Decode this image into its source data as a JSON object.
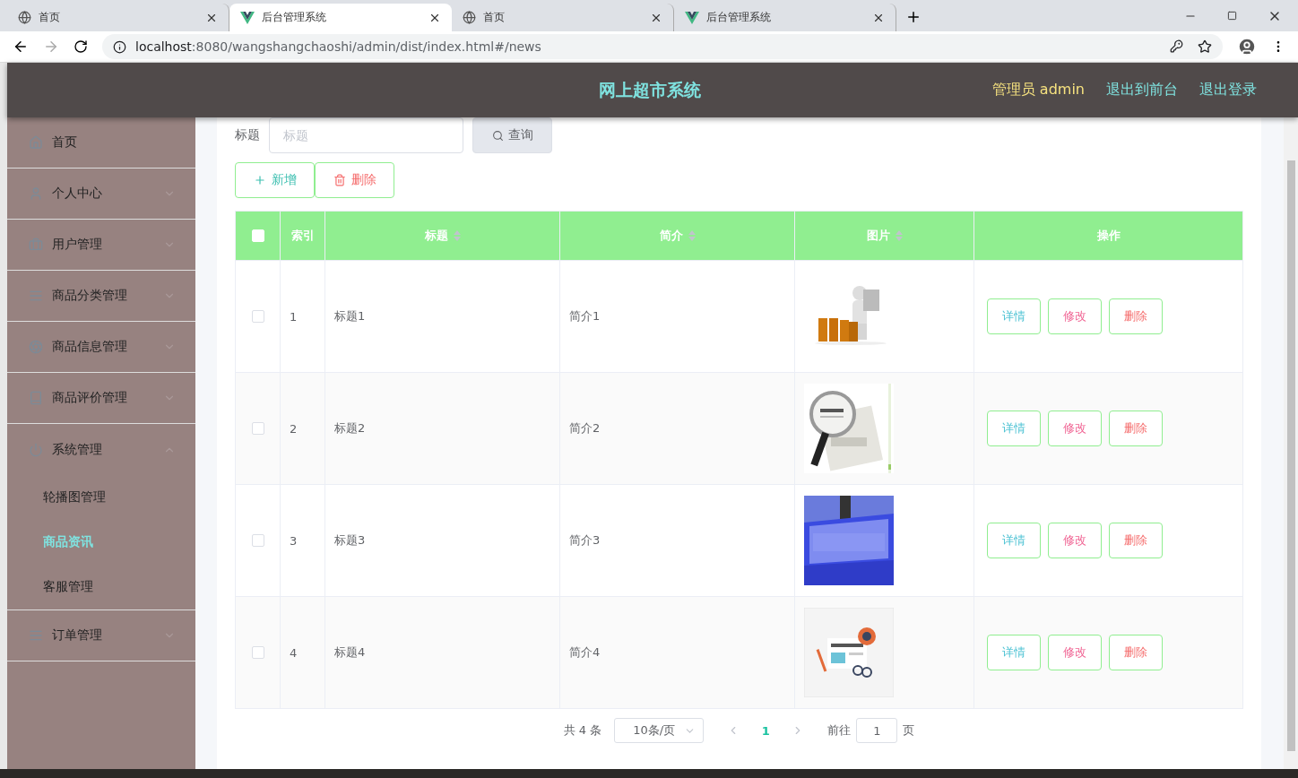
{
  "browser": {
    "tabs": [
      {
        "title": "首页",
        "kind": "globe",
        "selected": false
      },
      {
        "title": "后台管理系统",
        "kind": "vue",
        "selected": true
      },
      {
        "title": "首页",
        "kind": "globe",
        "selected": false
      },
      {
        "title": "后台管理系统",
        "kind": "vue",
        "selected": false
      }
    ],
    "url_host": "localhost",
    "url_rest": ":8080/wangshangchaoshi/admin/dist/index.html#/news"
  },
  "header": {
    "title": "网上超市系统",
    "user": "管理员 admin",
    "links": [
      "退出到前台",
      "退出登录"
    ]
  },
  "sidebar": {
    "items": [
      {
        "label": "首页"
      },
      {
        "label": "个人中心",
        "expanded": false
      },
      {
        "label": "用户管理",
        "expanded": false
      },
      {
        "label": "商品分类管理",
        "expanded": false
      },
      {
        "label": "商品信息管理",
        "expanded": false
      },
      {
        "label": "商品评价管理",
        "expanded": false
      },
      {
        "label": "系统管理",
        "expanded": true,
        "children": [
          {
            "label": "轮播图管理",
            "selected": false
          },
          {
            "label": "商品资讯",
            "selected": true
          },
          {
            "label": "客服管理",
            "selected": false
          }
        ]
      },
      {
        "label": "订单管理",
        "expanded": false
      }
    ]
  },
  "search": {
    "label": "标题",
    "placeholder": "标题",
    "button": "查询"
  },
  "toolbar": [
    {
      "label": "新增",
      "kind": "add"
    },
    {
      "label": "删除",
      "kind": "delete"
    }
  ],
  "table": {
    "header_checked": false,
    "columns": [
      {
        "label": "索引",
        "sortable": false
      },
      {
        "label": "标题",
        "sortable": true
      },
      {
        "label": "简介",
        "sortable": true
      },
      {
        "label": "图片",
        "sortable": true
      },
      {
        "label": "操作",
        "sortable": false
      }
    ],
    "rows": [
      {
        "checked": false,
        "index": "1",
        "title": "标题1",
        "intro": "简介1",
        "actions": [
          {
            "label": "详情",
            "kind": "detail"
          },
          {
            "label": "修改",
            "kind": "edit"
          },
          {
            "label": "删除",
            "kind": "delete"
          }
        ]
      },
      {
        "checked": false,
        "index": "2",
        "title": "标题2",
        "intro": "简介2",
        "actions": [
          {
            "label": "详情",
            "kind": "detail"
          },
          {
            "label": "修改",
            "kind": "edit"
          },
          {
            "label": "删除",
            "kind": "delete"
          }
        ]
      },
      {
        "checked": false,
        "index": "3",
        "title": "标题3",
        "intro": "简介3",
        "actions": [
          {
            "label": "详情",
            "kind": "detail"
          },
          {
            "label": "修改",
            "kind": "edit"
          },
          {
            "label": "删除",
            "kind": "delete"
          }
        ]
      },
      {
        "checked": false,
        "index": "4",
        "title": "标题4",
        "intro": "简介4",
        "actions": [
          {
            "label": "详情",
            "kind": "detail"
          },
          {
            "label": "修改",
            "kind": "edit"
          },
          {
            "label": "删除",
            "kind": "delete"
          }
        ]
      }
    ]
  },
  "pagination": {
    "total": "共 4 条",
    "page_size": "10条/页",
    "pages": [
      {
        "label": "1",
        "selected": true
      }
    ],
    "goto_label": "前往",
    "goto_value": "1",
    "goto_suffix": "页"
  }
}
